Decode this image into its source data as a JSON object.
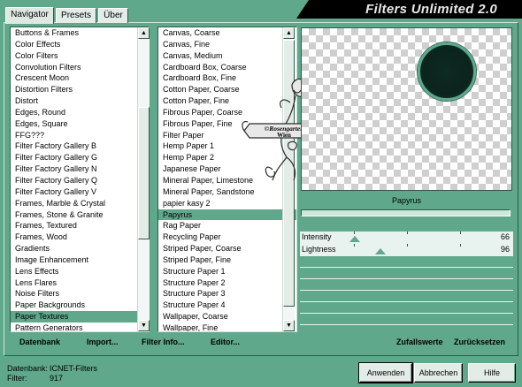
{
  "app": {
    "title": "Filters Unlimited 2.0"
  },
  "tabs": [
    {
      "label": "Navigator",
      "active": true
    },
    {
      "label": "Presets",
      "active": false
    },
    {
      "label": "Über",
      "active": false
    }
  ],
  "categories": {
    "items": [
      "Buttons & Frames",
      "Color Effects",
      "Color Filters",
      "Convolution Filters",
      "Crescent Moon",
      "Distortion Filters",
      "Distort",
      "Edges, Round",
      "Edges, Square",
      "FFG???",
      "Filter Factory Gallery B",
      "Filter Factory Gallery G",
      "Filter Factory Gallery N",
      "Filter Factory Gallery Q",
      "Filter Factory Gallery V",
      "Frames, Marble & Crystal",
      "Frames, Stone & Granite",
      "Frames, Textured",
      "Frames, Wood",
      "Gradients",
      "Image Enhancement",
      "Lens Effects",
      "Lens Flares",
      "Noise Filters",
      "Paper Backgrounds",
      "Paper Textures",
      "Pattern Generators"
    ],
    "selected": "Paper Textures"
  },
  "filters": {
    "items": [
      "Canvas, Coarse",
      "Canvas, Fine",
      "Canvas, Medium",
      "Cardboard Box, Coarse",
      "Cardboard Box, Fine",
      "Cotton Paper, Coarse",
      "Cotton Paper, Fine",
      "Fibrous Paper, Coarse",
      "Fibrous Paper, Fine",
      "Filter Paper",
      "Hemp Paper 1",
      "Hemp Paper 2",
      "Japanese Paper",
      "Mineral Paper, Limestone",
      "Mineral Paper, Sandstone",
      "papier kasy 2",
      "Papyrus",
      "Rag Paper",
      "Recycling Paper",
      "Striped Paper, Coarse",
      "Striped Paper, Fine",
      "Structure Paper 1",
      "Structure Paper 2",
      "Structure Paper 3",
      "Structure Paper 4",
      "Wallpaper, Coarse",
      "Wallpaper, Fine"
    ],
    "selected": "Papyrus"
  },
  "watermark": {
    "line1": "©Rosengarten",
    "line2": "Wien"
  },
  "preview": {
    "filter_name": "Papyrus"
  },
  "sliders": [
    {
      "label": "Intensity",
      "value": "66",
      "value_num": 66
    },
    {
      "label": "Lightness",
      "value": "96",
      "value_num": 96
    }
  ],
  "toolbar": {
    "datenbank": "Datenbank",
    "import": "Import...",
    "filter_info": "Filter Info...",
    "editor": "Editor...",
    "zufallswerte": "Zufallswerte",
    "zuruecksetzen": "Zurücksetzen"
  },
  "footer": {
    "datenbank_label": "Datenbank:",
    "datenbank_value": "ICNET-Filters",
    "filter_label": "Filter:",
    "filter_value": "917"
  },
  "buttons": {
    "apply": "Anwenden",
    "cancel": "Abbrechen",
    "help": "Hilfe"
  },
  "colors": {
    "background": "#5fa88b",
    "selection": "#5fa88b",
    "title_bar": "#000000",
    "title_text": "#e8e8e8"
  }
}
